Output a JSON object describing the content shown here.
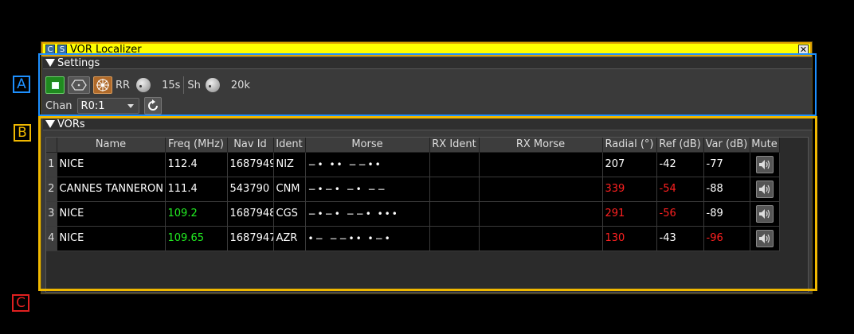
{
  "window": {
    "title": "VOR Localizer",
    "title_buttons": [
      "C",
      "S"
    ]
  },
  "settings": {
    "header": "Settings",
    "rr_label": "RR",
    "rr_value": "15s",
    "sh_label": "Sh",
    "sh_value": "20k",
    "chan_label": "Chan",
    "chan_value": "R0:1"
  },
  "vors": {
    "header": "VORs",
    "columns": [
      "Name",
      "Freq (MHz)",
      "Nav Id",
      "Ident",
      "Morse",
      "RX Ident",
      "RX Morse",
      "Radial (°)",
      "Ref (dB)",
      "Var (dB)",
      "Mute"
    ],
    "rows": [
      {
        "num": "1",
        "name": "NICE",
        "freq": "112.4",
        "nav_id": "1687949",
        "ident": "NIZ",
        "morse": "−• •• −−••",
        "rx_ident": "",
        "rx_morse": "",
        "radial": "207",
        "ref": "-42",
        "var": "-77"
      },
      {
        "num": "2",
        "name": "CANNES TANNERON",
        "freq": "111.4",
        "nav_id": "543790",
        "ident": "CNM",
        "morse": "−•−• −• −−",
        "rx_ident": "",
        "rx_morse": "",
        "radial": "339",
        "ref": "-54",
        "var": "-88"
      },
      {
        "num": "3",
        "name": "NICE",
        "freq": "109.2",
        "nav_id": "1687948",
        "ident": "CGS",
        "morse": "−•−• −−• •••",
        "rx_ident": "",
        "rx_morse": "",
        "radial": "291",
        "ref": "-56",
        "var": "-89"
      },
      {
        "num": "4",
        "name": "NICE",
        "freq": "109.65",
        "nav_id": "1687947",
        "ident": "AZR",
        "morse": "•− −−•• •−•",
        "rx_ident": "",
        "rx_morse": "",
        "radial": "130",
        "ref": "-43",
        "var": "-96"
      }
    ]
  },
  "callouts": {
    "a": "A",
    "b": "B",
    "c": "C"
  },
  "colors": {
    "title_bg": "#ffff00",
    "box_a": "#1e90ff",
    "box_b": "#f0b800",
    "callout_c": "#e02020",
    "warn_red": "#ff2020",
    "ok_green": "#22ee22"
  }
}
